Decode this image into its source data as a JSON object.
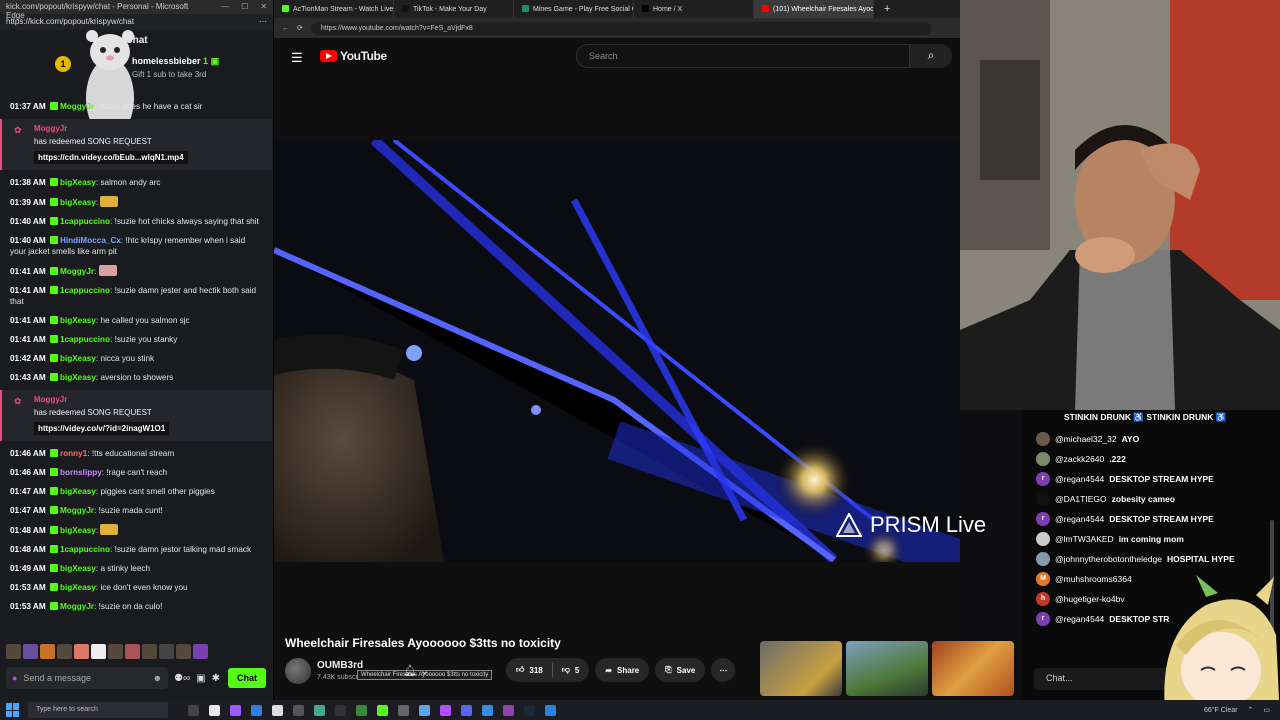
{
  "kick": {
    "window_title": "kick.com/popout/krispyw/chat - Personal - Microsoft Edge",
    "url": "https://kick.com/popout/krispyw/chat",
    "header": "Chat",
    "sub_gift": {
      "rank": "1",
      "user": "homelessbieber",
      "count": "1",
      "subtitle": "Gift 1 sub to take 3rd"
    },
    "cutoff_line": "he have a cat sir",
    "messages": [
      {
        "ts": "01:37 AM",
        "nick": "MoggyJr",
        "color": "#53fc18",
        "text": ":suzie does he have a cat sir",
        "kind": "msg"
      },
      {
        "ts": "",
        "nick": "MoggyJr",
        "color": "#e84f7a",
        "text": "has redeemed SONG REQUEST",
        "link": "https://cdn.videy.co/bEub...wlqN1.mp4",
        "kind": "redeem"
      },
      {
        "ts": "01:38 AM",
        "nick": "bigXeasy",
        "color": "#53fc18",
        "text": "salmon andy arc",
        "kind": "msg"
      },
      {
        "ts": "01:39 AM",
        "nick": "bigXeasy",
        "color": "#53fc18",
        "text": "",
        "emote": "#e0b13a",
        "kind": "msg"
      },
      {
        "ts": "01:40 AM",
        "nick": "1cappuccino",
        "color": "#53fc18",
        "text": "!suzie hot chicks always saying that shit",
        "kind": "msg"
      },
      {
        "ts": "01:40 AM",
        "nick": "HindiMocca_Cx",
        "color": "#7aa7ff",
        "text": "!htc krispy remember when i said your jacket smells like arm pit",
        "kind": "msg"
      },
      {
        "ts": "01:41 AM",
        "nick": "MoggyJr",
        "color": "#53fc18",
        "text": "",
        "emote": "#d9a0a0",
        "kind": "msg"
      },
      {
        "ts": "01:41 AM",
        "nick": "1cappuccino",
        "color": "#53fc18",
        "text": "!suzie damn jester and hectik both said that",
        "kind": "msg"
      },
      {
        "ts": "01:41 AM",
        "nick": "bigXeasy",
        "color": "#53fc18",
        "text": "he called you salmon sjc",
        "kind": "msg"
      },
      {
        "ts": "01:41 AM",
        "nick": "1cappuccino",
        "color": "#53fc18",
        "text": "!suzie you stanky",
        "kind": "msg"
      },
      {
        "ts": "01:42 AM",
        "nick": "bigXeasy",
        "color": "#53fc18",
        "text": "nicca you stink",
        "kind": "msg"
      },
      {
        "ts": "01:43 AM",
        "nick": "bigXeasy",
        "color": "#53fc18",
        "text": "aversion to showers",
        "kind": "msg"
      },
      {
        "ts": "",
        "nick": "MoggyJr",
        "color": "#e84f7a",
        "text": "has redeemed SONG REQUEST",
        "link": "https://videy.co/v/?id=2inagW1O1",
        "kind": "redeem"
      },
      {
        "ts": "01:46 AM",
        "nick": "ronny1",
        "color": "#ff6b6b",
        "text": "!tts educational stream",
        "kind": "msg"
      },
      {
        "ts": "01:46 AM",
        "nick": "bornslippy",
        "color": "#c88bff",
        "text": "!rage can't reach",
        "kind": "msg"
      },
      {
        "ts": "01:47 AM",
        "nick": "bigXeasy",
        "color": "#53fc18",
        "text": "piggies cant smell other piggies",
        "kind": "msg"
      },
      {
        "ts": "01:47 AM",
        "nick": "MoggyJr",
        "color": "#53fc18",
        "text": "!suzie mada cunt!",
        "kind": "msg"
      },
      {
        "ts": "01:48 AM",
        "nick": "bigXeasy",
        "color": "#53fc18",
        "text": "",
        "emote": "#e0b13a",
        "kind": "msg"
      },
      {
        "ts": "01:48 AM",
        "nick": "1cappuccino",
        "color": "#53fc18",
        "text": "!suzie damn jestor talking mad smack",
        "kind": "msg"
      },
      {
        "ts": "01:49 AM",
        "nick": "bigXeasy",
        "color": "#53fc18",
        "text": "a stinky leech",
        "kind": "msg"
      },
      {
        "ts": "01:53 AM",
        "nick": "bigXeasy",
        "color": "#53fc18",
        "text": "ice don't even know you",
        "kind": "msg"
      },
      {
        "ts": "01:53 AM",
        "nick": "MoggyJr",
        "color": "#53fc18",
        "text": "!suzie on da culo!",
        "kind": "msg"
      }
    ],
    "input_placeholder": "Send a message",
    "chat_button": "Chat"
  },
  "browser": {
    "tabs": [
      {
        "label": "AcTionMan Stream - Watch Live o",
        "fav": "#53fc18",
        "active": false
      },
      {
        "label": "TikTok - Make Your Day",
        "fav": "#111111",
        "active": false
      },
      {
        "label": "Mines Game - Play Free Social Ca",
        "fav": "#1f8f5f",
        "active": false
      },
      {
        "label": "Home / X",
        "fav": "#000000",
        "active": false
      },
      {
        "label": "(101) Wheelchair Firesales Ayooo",
        "fav": "#ff0000",
        "active": true
      }
    ],
    "url": "https://www.youtube.com/watch?v=FeS_aVjdFx8"
  },
  "youtube": {
    "logo": "YouTube",
    "search_placeholder": "Search",
    "video_title": "Wheelchair Firesales Ayoooooo $3tts no toxicity",
    "tooltip": "Wheelchair Firesales Ayoooooo $3tts no toxicity",
    "channel": "OUMB3rd",
    "subscribers": "7.43K subscribers",
    "likes": "318",
    "dislikes": "5",
    "share": "Share",
    "save": "Save"
  },
  "overlay": {
    "prism": "PRISM Live",
    "top_line": "STINKIN DRUNK ♿ STINKIN DRUNK ♿",
    "rows": [
      {
        "user": "@michael32_32",
        "text": "AYO",
        "av": "#6b5a4a",
        "letter": ""
      },
      {
        "user": "@zackk2640",
        "text": ".222",
        "av": "#7a8a6a",
        "letter": ""
      },
      {
        "user": "@regan4544",
        "text": "DESKTOP STREAM HYPE",
        "av": "#7e3fb5",
        "letter": "r"
      },
      {
        "user": "@DA1TIEGO",
        "text": "zobesity cameo",
        "av": "#111111",
        "letter": ""
      },
      {
        "user": "@regan4544",
        "text": "DESKTOP STREAM HYPE",
        "av": "#7e3fb5",
        "letter": "r"
      },
      {
        "user": "@lmTW3AKED",
        "text": "im coming mom",
        "av": "#cccccc",
        "letter": ""
      },
      {
        "user": "@johnnytherobotontheledge",
        "text": "HOSPITAL HYPE",
        "av": "#8899aa",
        "letter": ""
      },
      {
        "user": "@muhshrooms6364",
        "text": "",
        "av": "#e07a2a",
        "letter": "M"
      },
      {
        "user": "@hugetiger-ko4bv",
        "text": "",
        "av": "#c0392b",
        "letter": "h"
      },
      {
        "user": "@regan4544",
        "text": "DESKTOP STR",
        "av": "#7e3fb5",
        "letter": "r"
      }
    ],
    "chat_placeholder": "Chat..."
  },
  "taskbar": {
    "search_placeholder": "Type here to search",
    "weather": "66°F Clear"
  }
}
